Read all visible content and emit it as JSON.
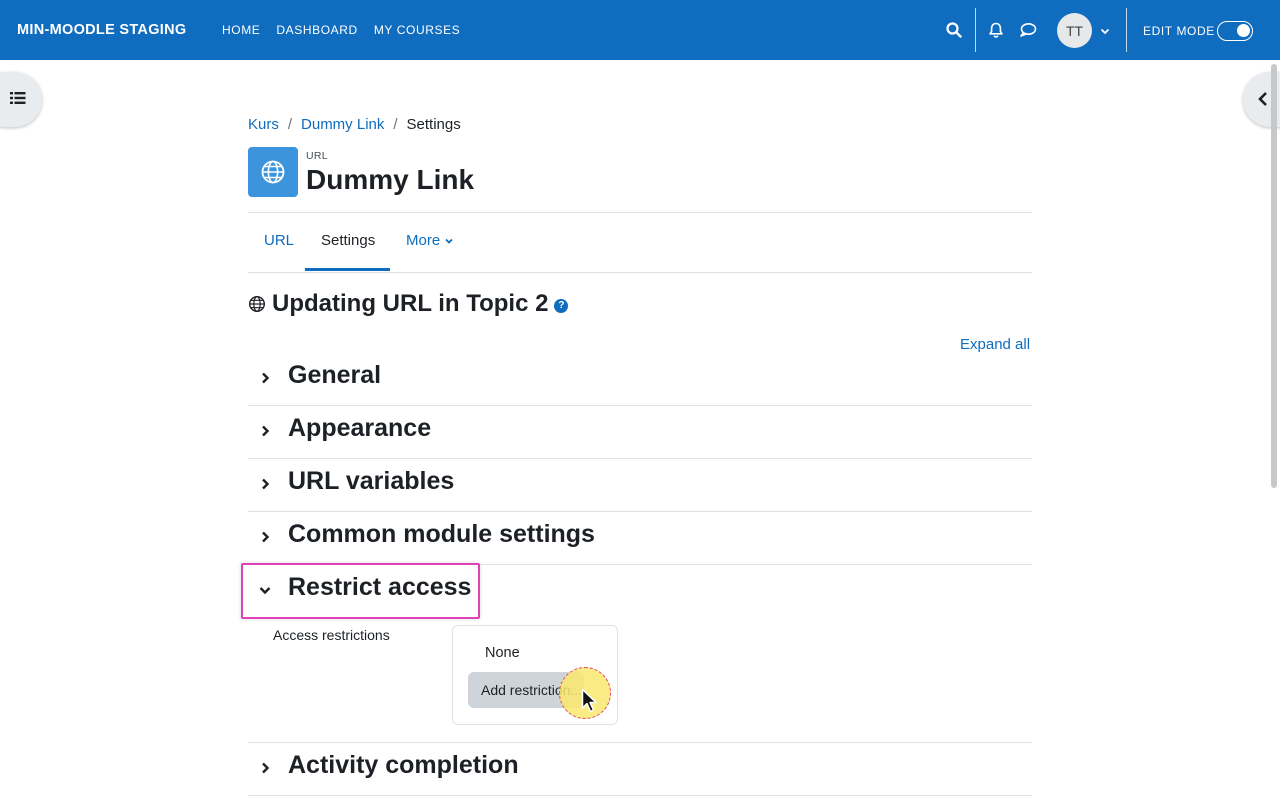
{
  "navbar": {
    "brand": "MIN-MOODLE STAGING",
    "links": [
      "HOME",
      "DASHBOARD",
      "MY COURSES"
    ],
    "avatar_initials": "TT",
    "edit_mode_label": "EDIT MODE",
    "edit_mode_on": true,
    "color": "#0f6cbf"
  },
  "breadcrumb": {
    "items": [
      "Kurs",
      "Dummy Link",
      "Settings"
    ],
    "separator": "/"
  },
  "header": {
    "activity_type": "URL",
    "title": "Dummy Link",
    "icon": "globe-icon",
    "icon_bg": "#3b94dc"
  },
  "tabs": {
    "items": [
      "URL",
      "Settings",
      "More"
    ],
    "active": "Settings"
  },
  "form": {
    "heading": "Updating URL in Topic 2",
    "help_glyph": "?",
    "expand_all": "Expand all",
    "sections": [
      {
        "title": "General",
        "expanded": false
      },
      {
        "title": "Appearance",
        "expanded": false
      },
      {
        "title": "URL variables",
        "expanded": false
      },
      {
        "title": "Common module settings",
        "expanded": false
      },
      {
        "title": "Restrict access",
        "expanded": true
      },
      {
        "title": "Activity completion",
        "expanded": false
      }
    ],
    "restrict": {
      "label": "Access restrictions",
      "value": "None",
      "add_button": "Add restriction..."
    }
  },
  "colors": {
    "accent": "#0f6cbf",
    "highlight": "#e040b8",
    "click_halo": "#fae86e"
  }
}
